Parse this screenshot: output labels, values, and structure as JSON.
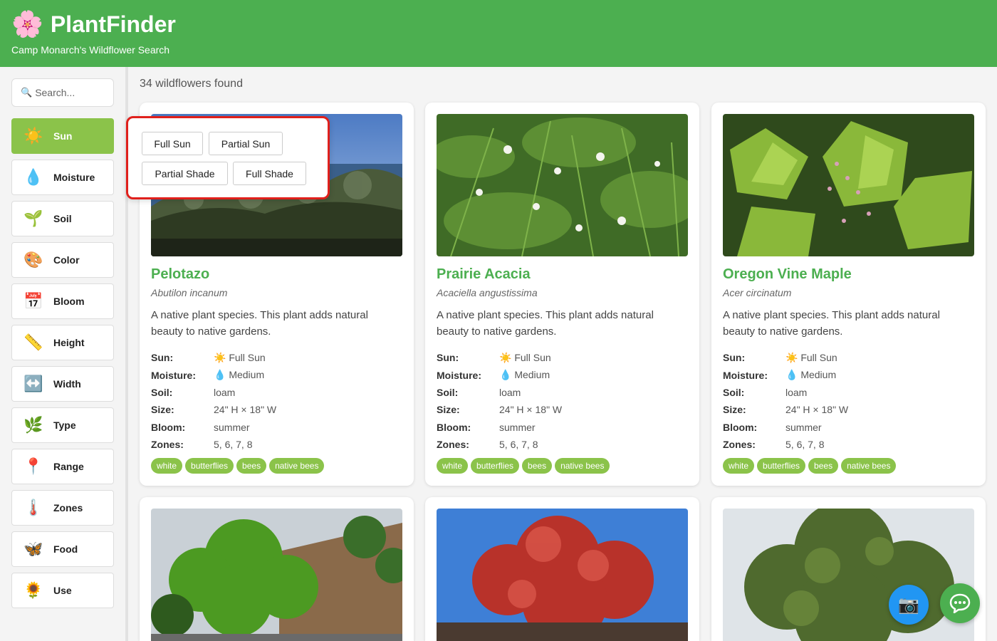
{
  "app": {
    "logo_glyph": "🌸",
    "title": "PlantFinder",
    "subtitle": "Camp Monarch's Wildflower Search"
  },
  "search": {
    "placeholder": "Search...",
    "icon": "🔍"
  },
  "filters": [
    {
      "label": "Sun",
      "icon": "☀️",
      "active": true
    },
    {
      "label": "Moisture",
      "icon": "💧",
      "active": false
    },
    {
      "label": "Soil",
      "icon": "🌱",
      "active": false
    },
    {
      "label": "Color",
      "icon": "🎨",
      "active": false
    },
    {
      "label": "Bloom",
      "icon": "📅",
      "active": false
    },
    {
      "label": "Height",
      "icon": "📏",
      "active": false
    },
    {
      "label": "Width",
      "icon": "↔️",
      "active": false
    },
    {
      "label": "Type",
      "icon": "🌿",
      "active": false
    },
    {
      "label": "Range",
      "icon": "📍",
      "active": false
    },
    {
      "label": "Zones",
      "icon": "🌡️",
      "active": false
    },
    {
      "label": "Food",
      "icon": "🦋",
      "active": false
    },
    {
      "label": "Use",
      "icon": "🌻",
      "active": false
    }
  ],
  "results_count": "34 wildflowers found",
  "sun_options": [
    "Full Sun",
    "Partial Sun",
    "Partial Shade",
    "Full Shade"
  ],
  "attr_labels": {
    "sun": "Sun:",
    "moisture": "Moisture:",
    "soil": "Soil:",
    "size": "Size:",
    "bloom": "Bloom:",
    "zones": "Zones:"
  },
  "plants": [
    {
      "name": "Pelotazo",
      "scientific": "Abutilon incanum",
      "description": "A native plant species. This plant adds natural beauty to native gardens.",
      "sun": "☀️ Full Sun",
      "moisture": "💧 Medium",
      "soil": "loam",
      "size": "24\" H × 18\" W",
      "bloom": "summer",
      "zones": "5, 6, 7, 8",
      "tags": [
        "white",
        "butterflies",
        "bees",
        "native bees"
      ]
    },
    {
      "name": "Prairie Acacia",
      "scientific": "Acaciella angustissima",
      "description": "A native plant species. This plant adds natural beauty to native gardens.",
      "sun": "☀️ Full Sun",
      "moisture": "💧 Medium",
      "soil": "loam",
      "size": "24\" H × 18\" W",
      "bloom": "summer",
      "zones": "5, 6, 7, 8",
      "tags": [
        "white",
        "butterflies",
        "bees",
        "native bees"
      ]
    },
    {
      "name": "Oregon Vine Maple",
      "scientific": "Acer circinatum",
      "description": "A native plant species. This plant adds natural beauty to native gardens.",
      "sun": "☀️ Full Sun",
      "moisture": "💧 Medium",
      "soil": "loam",
      "size": "24\" H × 18\" W",
      "bloom": "summer",
      "zones": "5, 6, 7, 8",
      "tags": [
        "white",
        "butterflies",
        "bees",
        "native bees"
      ]
    }
  ],
  "fab": {
    "camera_icon": "📷",
    "chat_icon": "💬"
  },
  "colors": {
    "header": "#4caf50",
    "accent": "#8bc34a",
    "highlight": "#e0201c",
    "camera": "#2196f3"
  }
}
